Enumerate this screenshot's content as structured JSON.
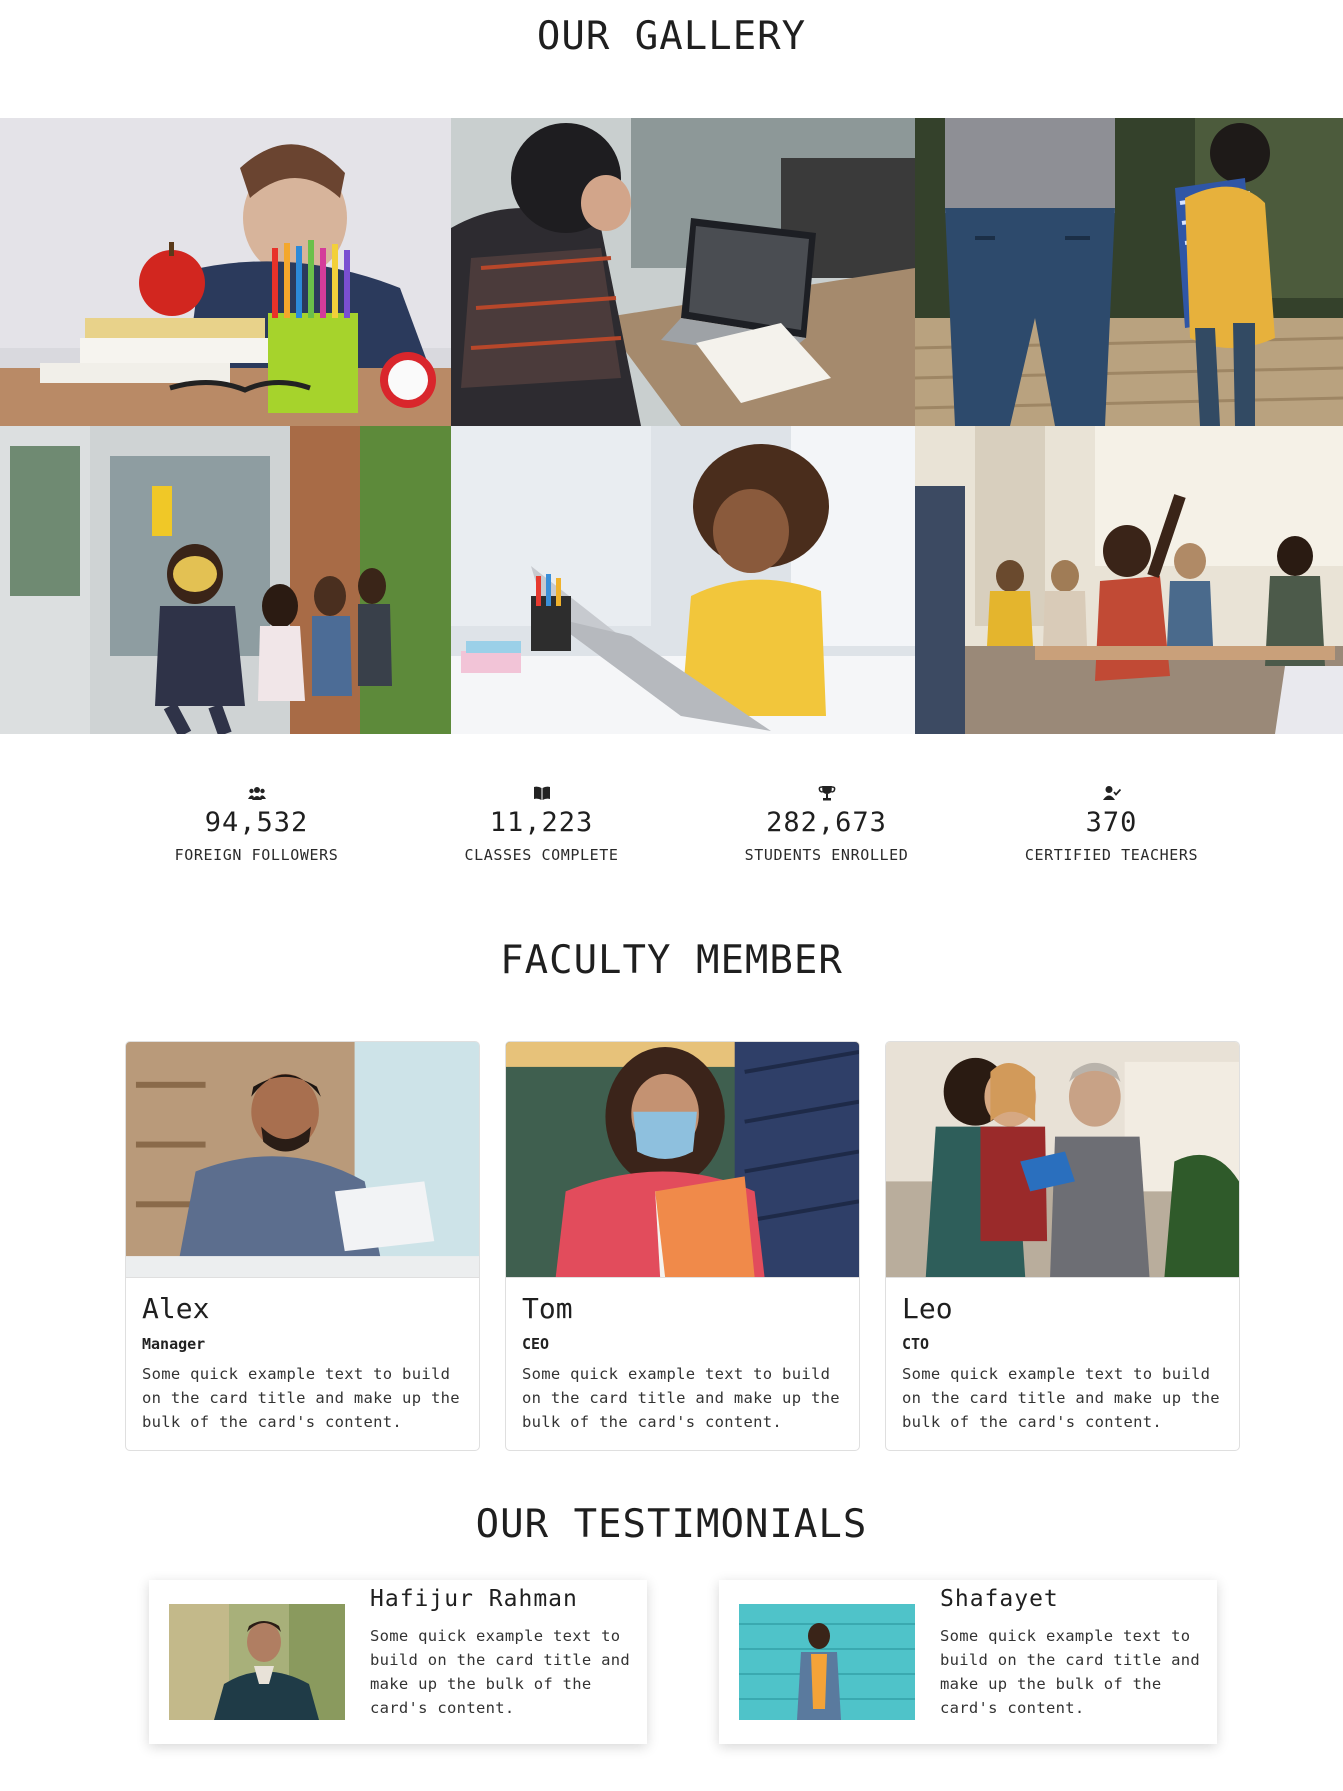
{
  "gallery": {
    "title": "OUR GALLERY",
    "images": [
      {
        "name": "apple-pencils-boy-photo"
      },
      {
        "name": "boy-laptop-desk-photo"
      },
      {
        "name": "boy-backpack-walking-photo"
      },
      {
        "name": "masked-kids-school-photo"
      },
      {
        "name": "girl-laptop-smiling-photo"
      },
      {
        "name": "classroom-students-photo"
      }
    ]
  },
  "stats": [
    {
      "icon": "users-icon",
      "value": "94,532",
      "label": "FOREIGN FOLLOWERS"
    },
    {
      "icon": "book-icon",
      "value": "11,223",
      "label": "CLASSES COMPLETE"
    },
    {
      "icon": "trophy-icon",
      "value": "282,673",
      "label": "STUDENTS ENROLLED"
    },
    {
      "icon": "user-check-icon",
      "value": "370",
      "label": "CERTIFIED TEACHERS"
    }
  ],
  "faculty": {
    "title": "FACULTY MEMBER",
    "members": [
      {
        "name": "Alex",
        "role": "Manager",
        "text": "Some quick example text to build on the card title and make up the bulk of the card's content."
      },
      {
        "name": "Tom",
        "role": "CEO",
        "text": "Some quick example text to build on the card title and make up the bulk of the card's content."
      },
      {
        "name": "Leo",
        "role": "CTO",
        "text": "Some quick example text to build on the card title and make up the bulk of the card's content."
      }
    ]
  },
  "testimonials": {
    "title": "OUR TESTIMONIALS",
    "items": [
      {
        "name": "Hafijur Rahman",
        "text": "Some quick example text to build on the card title and make up the bulk of the card's content."
      },
      {
        "name": "Shafayet",
        "text": "Some quick example text to build on the card title and make up the bulk of the card's content."
      }
    ]
  }
}
